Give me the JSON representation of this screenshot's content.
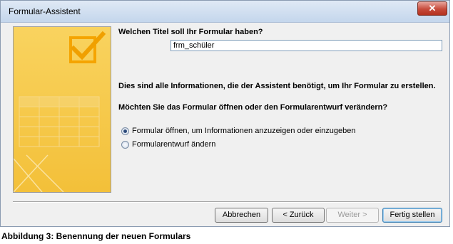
{
  "window": {
    "title": "Formular-Assistent",
    "close_label": "✕"
  },
  "form": {
    "title_question": "Welchen Titel soll Ihr Formular haben?",
    "title_value": "frm_schüler",
    "info_text": "Dies sind alle Informationen, die der Assistent benötigt, um Ihr Formular zu erstellen.",
    "open_question": "Möchten Sie das Formular öffnen oder den Formularentwurf verändern?",
    "options": [
      {
        "label": "Formular öffnen, um Informationen anzuzeigen oder einzugeben",
        "checked": true
      },
      {
        "label": "Formularentwurf ändern",
        "checked": false
      }
    ]
  },
  "buttons": {
    "cancel": "Abbrechen",
    "back": "< Zurück",
    "next": "Weiter >",
    "finish": "Fertig stellen"
  },
  "caption": "Abbildung 3: Benennung der neuen Formulars",
  "colors": {
    "art_background": "#f5c542",
    "art_accent": "#f0a800"
  },
  "icons": {
    "art": "form-wizard-art",
    "check": "checkmark-icon"
  }
}
